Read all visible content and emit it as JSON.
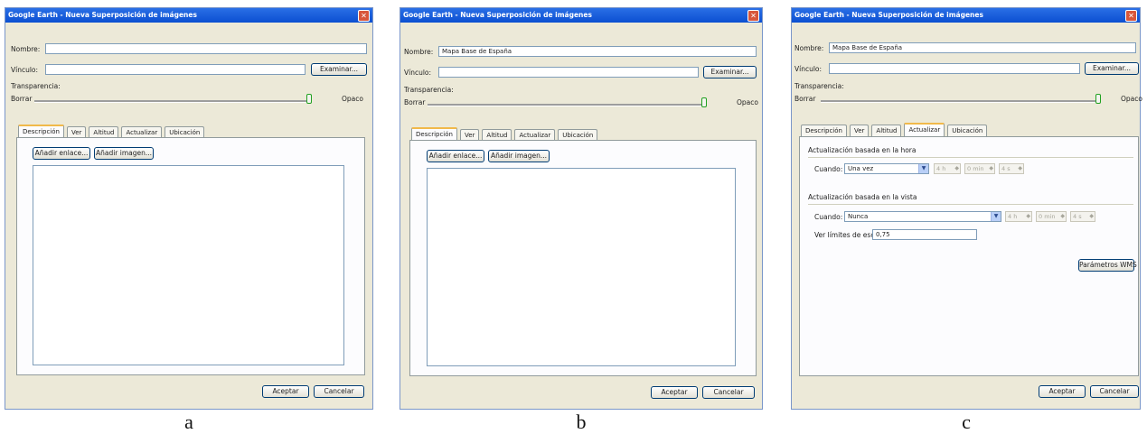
{
  "window_title": "Google Earth - Nueva Superposición de imágenes",
  "close_glyph": "✕",
  "labels": {
    "nombre": "Nombre:",
    "vinculo": "Vínculo:",
    "transparencia": "Transparencia:",
    "borrar": "Borrar",
    "opaco": "Opaco"
  },
  "buttons": {
    "examinar": "Examinar...",
    "aceptar": "Aceptar",
    "cancelar": "Cancelar",
    "anadir_enlace": "Añadir enlace...",
    "anadir_imagen": "Añadir imagen...",
    "parametros_wms": "Parámetros WMS"
  },
  "tabs": [
    "Descripción",
    "Ver",
    "Altitud",
    "Actualizar",
    "Ubicación"
  ],
  "dialog_a": {
    "nombre_value": "",
    "vinculo_value": "",
    "active_tab": "Descripción",
    "caption": "a"
  },
  "dialog_b": {
    "nombre_value": "Mapa Base de España",
    "vinculo_value": "",
    "active_tab": "Descripción",
    "caption": "b"
  },
  "dialog_c": {
    "nombre_value": "Mapa Base de España",
    "vinculo_value": "",
    "active_tab": "Actualizar",
    "caption": "c",
    "refresh_time": {
      "title": "Actualización basada en la hora",
      "cuando_label": "Cuando:",
      "cuando_value": "Una vez",
      "spin1": "4 h",
      "spin2": "0 min",
      "spin3": "4 s"
    },
    "refresh_view": {
      "title": "Actualización basada en la vista",
      "cuando_label": "Cuando:",
      "cuando_value": "Nunca",
      "spin1": "4 h",
      "spin2": "0 min",
      "spin3": "4 s",
      "limites_label": "Ver límites de escala:",
      "limites_value": "0,75"
    }
  },
  "transparency_level": 1.0,
  "colors": {
    "titlebar": "#0b4fd1",
    "dialog_bg": "#ece9d8",
    "tab_accent": "#f1b94a"
  }
}
